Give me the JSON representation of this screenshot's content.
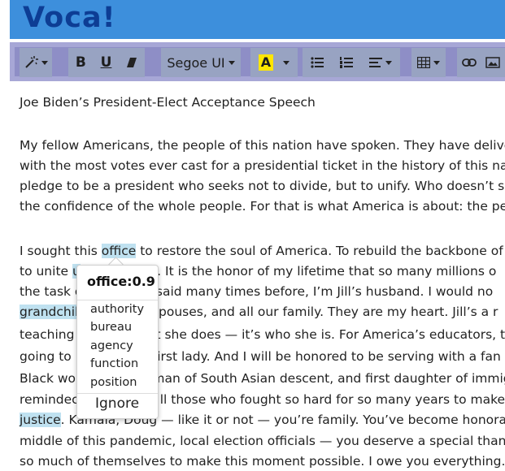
{
  "app": {
    "logo": "Voca!"
  },
  "toolbar": {
    "magic": "magic-wand",
    "bold": "B",
    "underline": "U",
    "eraser": "eraser",
    "font": "Segoe UI",
    "color": "A",
    "colors": {
      "highlight_yellow": "#ffe600",
      "header_blue": "#3d8fdc",
      "logo_blue": "#0d3d94"
    }
  },
  "document": {
    "title": "Joe Biden’s President-Elect Acceptance Speech",
    "p1": [
      "My fellow Americans, the people of this nation have spoken. They have deliver",
      "with the most votes ever cast for a presidential ticket in the history of this nati",
      "pledge to be a president who seeks not to divide, but to unify. Who doesn’t se",
      "the confidence of the whole people. For that is what America is about: the peo"
    ],
    "p2": {
      "l1a": "I sought this ",
      "l1h": "office",
      "l1b": " to restore the soul of America. To rebuild the backbone of t",
      "l2a": "to unite ",
      "l2h": "u",
      "l2b": "ne. It is the honor of my lifetime that so many millions o",
      "l3a": "the task o",
      "l3b": "s I said many times before, I’m Jill’s husband. I would no",
      "l4h": "grandchil",
      "l4b": "ir spouses, and all our family. They are my heart. Jill’s a r",
      "l5a": "teaching",
      "l5b": "t she does — it’s who she is. For America’s educators, th",
      "l6a": "going to",
      "l6b": "first lady. And I will be honored to be serving with a fan",
      "l7a": "Black wor",
      "l7b": "man of South Asian descent, and first daughter of immig",
      "l8a": "remindec",
      "l8b": "ll those who fought so hard for so many years to make t",
      "l9h": "justice",
      "l9b": ". Kamala, Doug — like it or not — you’re family. You’ve become honorar",
      "l10": "middle of this pandemic, local election officials — you deserve a special thanks",
      "l11": "so much of themselves to make this moment possible. I owe you everything. A"
    }
  },
  "popup": {
    "title": "office:0.9",
    "synonyms": [
      "authority",
      "bureau",
      "agency",
      "function",
      "position"
    ],
    "ignore": "Ignore"
  }
}
